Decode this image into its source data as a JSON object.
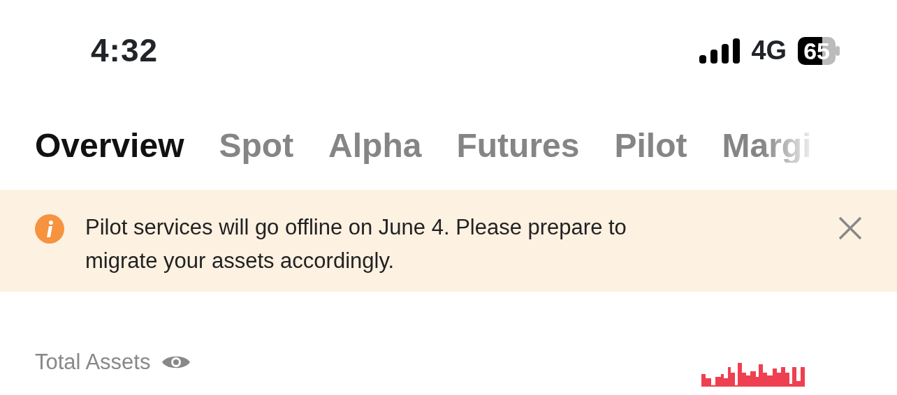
{
  "status_bar": {
    "time": "4:32",
    "network": "4G",
    "battery": "65"
  },
  "tabs": [
    {
      "label": "Overview",
      "selected": true
    },
    {
      "label": "Spot",
      "selected": false
    },
    {
      "label": "Alpha",
      "selected": false
    },
    {
      "label": "Futures",
      "selected": false
    },
    {
      "label": "Pilot",
      "selected": false
    },
    {
      "label": "Margi",
      "selected": false
    }
  ],
  "notice": {
    "message": "Pilot services will go offline on June 4. Please prepare to migrate your assets accordingly."
  },
  "assets": {
    "label": "Total Assets"
  }
}
